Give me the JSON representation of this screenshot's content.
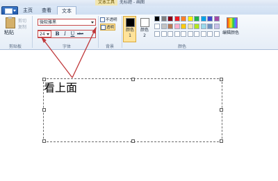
{
  "window": {
    "contextual_tab": "文本工具",
    "title": "无标题 - 画图"
  },
  "tabs": {
    "home": "主页",
    "view": "查看",
    "text": "文本"
  },
  "groups": {
    "clipboard": "剪贴板",
    "font": "字体",
    "background": "背景",
    "colors": "颜色"
  },
  "clipboard": {
    "paste": "粘贴",
    "cut": "剪切",
    "copy": "复制"
  },
  "font": {
    "family": "微软雅黑",
    "size": "24",
    "bold": "B",
    "italic": "I",
    "underline": "U",
    "strikethrough": "abc"
  },
  "background": {
    "opaque": "不透明",
    "transparent": "透明"
  },
  "colors": {
    "color1_label": "颜色 1",
    "color2_label": "颜色 2",
    "edit_colors": "编辑颜色",
    "color1_value": "#000000",
    "color2_value": "#ffffff",
    "palette": [
      "#000000",
      "#7f7f7f",
      "#880015",
      "#ed1c24",
      "#ff7f27",
      "#fff200",
      "#22b14c",
      "#00a2e8",
      "#3f48cc",
      "#a349a4",
      "#ffffff",
      "#c3c3c3",
      "#b97a57",
      "#ffaec9",
      "#ffc90e",
      "#efe4b0",
      "#b5e61d",
      "#99d9ea",
      "#7092be",
      "#c8bfe7",
      "#ffffff",
      "#ffffff",
      "#ffffff",
      "#ffffff",
      "#ffffff",
      "#ffffff",
      "#ffffff",
      "#ffffff",
      "#ffffff",
      "#ffffff"
    ]
  },
  "canvas": {
    "text": "看上面"
  },
  "annotation": {
    "color": "#c0393b"
  }
}
